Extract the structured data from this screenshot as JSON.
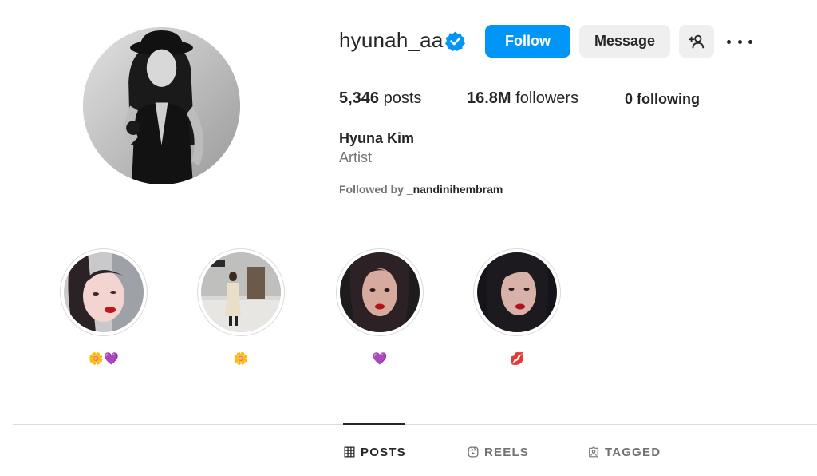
{
  "profile": {
    "username": "hyunah_aa",
    "verified": true,
    "full_name": "Hyuna Kim",
    "category": "Artist",
    "followed_by_prefix": "Followed by",
    "followed_by_user": "_nandinihembram"
  },
  "actions": {
    "follow_label": "Follow",
    "message_label": "Message",
    "add_user_icon": "person-add-icon",
    "more_icon": "more-options-icon"
  },
  "stats": {
    "posts_count": "5,346",
    "posts_label": "posts",
    "followers_count": "16.8M",
    "followers_label": "followers",
    "following_count": "0",
    "following_label": "following"
  },
  "highlights": [
    {
      "label": "🌼💜"
    },
    {
      "label": "🌼"
    },
    {
      "label": "💜"
    },
    {
      "label": "💋"
    }
  ],
  "tabs": [
    {
      "label": "POSTS",
      "icon": "grid-icon",
      "active": true
    },
    {
      "label": "REELS",
      "icon": "reels-icon",
      "active": false
    },
    {
      "label": "TAGGED",
      "icon": "tagged-icon",
      "active": false
    }
  ],
  "colors": {
    "accent": "#0095f6",
    "secondary_button": "#efefef",
    "muted_text": "#737373",
    "primary_text": "#262626"
  }
}
